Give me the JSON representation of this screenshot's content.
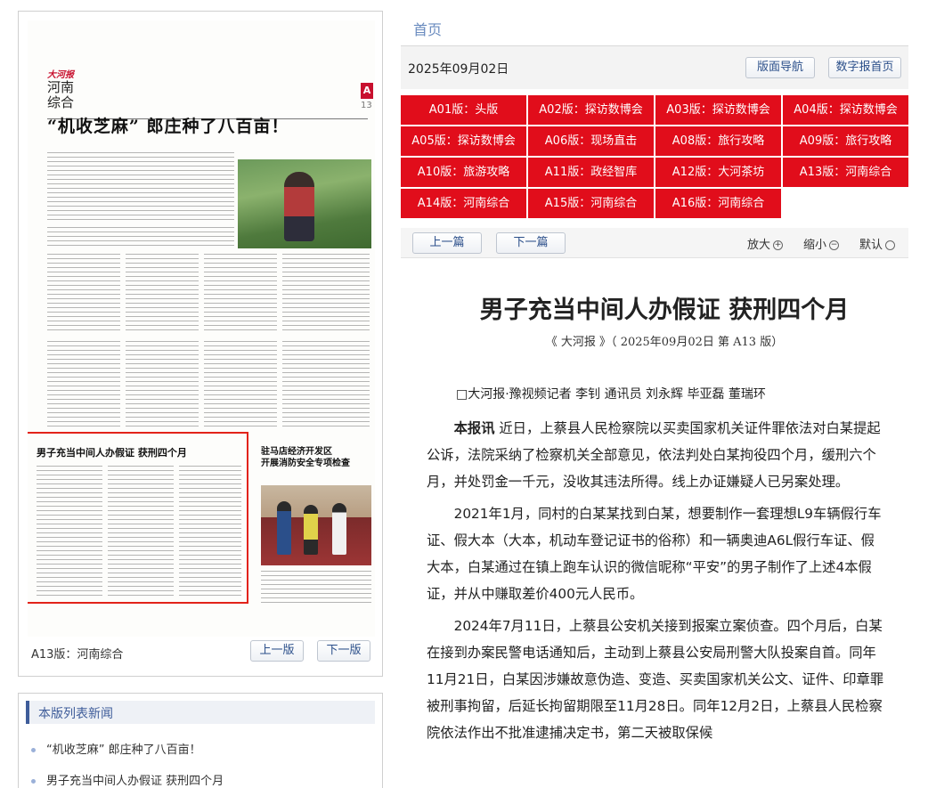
{
  "nav": {
    "home": "首页"
  },
  "date_bar": {
    "date": "2025年09月02日",
    "layout_nav": "版面导航",
    "digital_home": "数字报首页"
  },
  "editions": [
    "A01版：头版",
    "A02版：探访数博会",
    "A03版：探访数博会",
    "A04版：探访数博会",
    "A05版：探访数博会",
    "A06版：现场直击",
    "A08版：旅行攻略",
    "A09版：旅行攻略",
    "A10版：旅游攻略",
    "A11版：政经智库",
    "A12版：大河茶坊",
    "A13版：河南综合",
    "A14版：河南综合",
    "A15版：河南综合",
    "A16版：河南综合"
  ],
  "controls": {
    "prev": "上一篇",
    "next": "下一篇",
    "zoom_in": "放大",
    "zoom_out": "缩小",
    "default": "默认"
  },
  "article": {
    "title": "男子充当中间人办假证 获刑四个月",
    "source": "《 大河报 》（ 2025年09月02日 第 A13 版）",
    "byline": "□大河报·豫视频记者 李钊 通讯员 刘永辉 毕亚磊 董瑞环",
    "lead_label": "本报讯",
    "p1": "近日，上蔡县人民检察院以买卖国家机关证件罪依法对白某提起公诉，法院采纳了检察机关全部意见，依法判处白某拘役四个月，缓刑六个月，并处罚金一千元，没收其违法所得。线上办证嫌疑人已另案处理。",
    "p2": "2021年1月，同村的白某某找到白某，想要制作一套理想L9车辆假行车证、假大本（大本，机动车登记证书的俗称）和一辆奥迪A6L假行车证、假大本，白某通过在镇上跑车认识的微信昵称“平安”的男子制作了上述4本假证，并从中赚取差价400元人民币。",
    "p3": "2024年7月11日，上蔡县公安机关接到报案立案侦查。四个月后，白某在接到办案民警电话通知后，主动到上蔡县公安局刑警大队投案自首。同年11月21日，白某因涉嫌故意伪造、变造、买卖国家机关公文、证件、印章罪被刑事拘留，后延长拘留期限至11月28日。同年12月2日，上蔡县人民检察院依法作出不批准逮捕决定书，第二天被取保候"
  },
  "newspaper": {
    "masthead_tag": "大河报",
    "section": "河南综合",
    "page_letter": "A",
    "page_number": "13",
    "headline": "“机收芝麻” 郎庄种了八百亩！",
    "highlight_headline": "男子充当中间人办假证 获刑四个月",
    "side_headline_1": "驻马店经济开发区",
    "side_headline_2": "开展消防安全专项检查"
  },
  "left_panel": {
    "page_label": "A13版：河南综合",
    "prev": "上一版",
    "next": "下一版"
  },
  "list_panel": {
    "header": "本版列表新闻",
    "items": [
      "“机收芝麻” 郎庄种了八百亩！",
      "男子充当中间人办假证 获刑四个月"
    ]
  }
}
